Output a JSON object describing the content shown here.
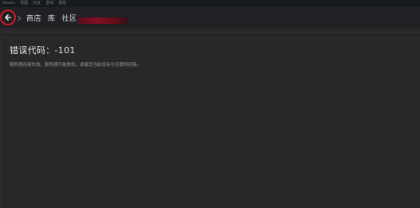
{
  "menubar": {
    "items": [
      "Steam",
      "视图",
      "好友",
      "游戏",
      "帮助"
    ]
  },
  "nav": {
    "store_label": "商店",
    "library_label": "库",
    "community_label": "社区"
  },
  "error": {
    "title": "错误代码：-101",
    "message": "服务器连接失败。服务器可能脱机，或者您当前没有与互联网连接。"
  },
  "colors": {
    "background": "#262626",
    "nav_background": "#1f2124",
    "highlight_circle": "#d0162a"
  }
}
